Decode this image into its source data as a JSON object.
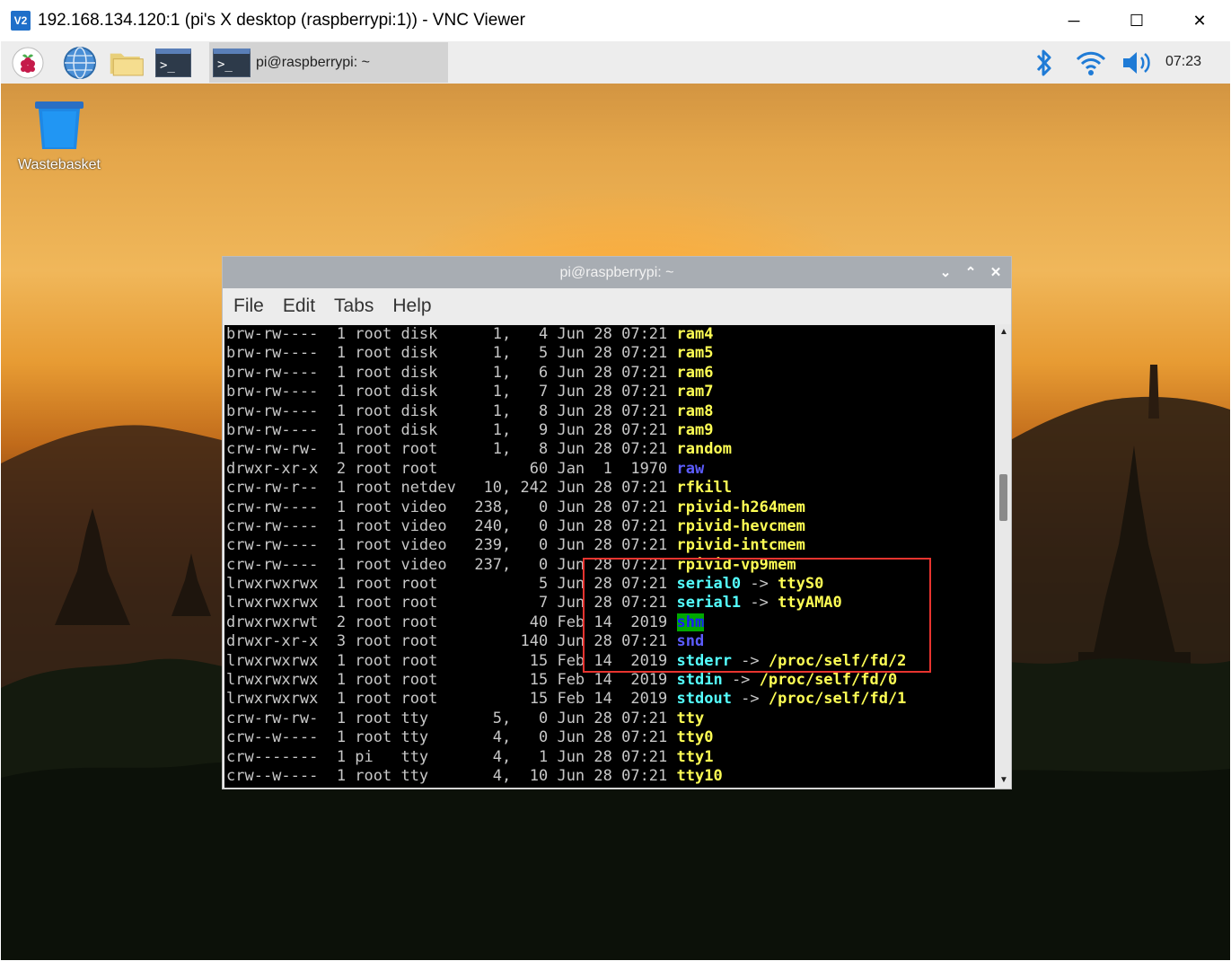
{
  "vnc": {
    "logo": "V2",
    "title": "192.168.134.120:1 (pi's X desktop (raspberrypi:1)) - VNC Viewer",
    "minimize": "─",
    "maximize": "☐",
    "close": "✕"
  },
  "taskbar": {
    "icons": [
      "raspberry-menu-icon",
      "web-browser-icon",
      "file-manager-icon",
      "terminal-icon"
    ],
    "task_label": "pi@raspberrypi: ~",
    "clock": "07:23",
    "tray": [
      "bluetooth-icon",
      "wifi-icon",
      "volume-icon"
    ]
  },
  "desktop": {
    "wastebasket_label": "Wastebasket"
  },
  "terminal": {
    "title": "pi@raspberrypi: ~",
    "menu": [
      "File",
      "Edit",
      "Tabs",
      "Help"
    ],
    "lines": [
      {
        "meta": "brw-rw----  1 root disk      1,   4 Jun 28 07:21 ",
        "name": "ram4",
        "color": "yellow"
      },
      {
        "meta": "brw-rw----  1 root disk      1,   5 Jun 28 07:21 ",
        "name": "ram5",
        "color": "yellow"
      },
      {
        "meta": "brw-rw----  1 root disk      1,   6 Jun 28 07:21 ",
        "name": "ram6",
        "color": "yellow"
      },
      {
        "meta": "brw-rw----  1 root disk      1,   7 Jun 28 07:21 ",
        "name": "ram7",
        "color": "yellow"
      },
      {
        "meta": "brw-rw----  1 root disk      1,   8 Jun 28 07:21 ",
        "name": "ram8",
        "color": "yellow"
      },
      {
        "meta": "brw-rw----  1 root disk      1,   9 Jun 28 07:21 ",
        "name": "ram9",
        "color": "yellow"
      },
      {
        "meta": "crw-rw-rw-  1 root root      1,   8 Jun 28 07:21 ",
        "name": "random",
        "color": "yellow"
      },
      {
        "meta": "drwxr-xr-x  2 root root          60 Jan  1  1970 ",
        "name": "raw",
        "color": "blue"
      },
      {
        "meta": "crw-rw-r--  1 root netdev   10, 242 Jun 28 07:21 ",
        "name": "rfkill",
        "color": "yellow"
      },
      {
        "meta": "crw-rw----  1 root video   238,   0 Jun 28 07:21 ",
        "name": "rpivid-h264mem",
        "color": "yellow"
      },
      {
        "meta": "crw-rw----  1 root video   240,   0 Jun 28 07:21 ",
        "name": "rpivid-hevcmem",
        "color": "yellow"
      },
      {
        "meta": "crw-rw----  1 root video   239,   0 Jun 28 07:21 ",
        "name": "rpivid-intcmem",
        "color": "yellow"
      },
      {
        "meta": "crw-rw----  1 root video   237,   0 Jun 28 07:21 ",
        "name": "rpivid-vp9mem",
        "color": "yellow"
      },
      {
        "meta": "lrwxrwxrwx  1 root root           5 Jun 28 07:21 ",
        "name": "serial0",
        "color": "cyan",
        "target": "ttyS0",
        "target_color": "yellow"
      },
      {
        "meta": "lrwxrwxrwx  1 root root           7 Jun 28 07:21 ",
        "name": "serial1",
        "color": "cyan",
        "target": "ttyAMA0",
        "target_color": "yellow"
      },
      {
        "meta": "drwxrwxrwt  2 root root          40 Feb 14  2019 ",
        "name": "shm",
        "color": "shm"
      },
      {
        "meta": "drwxr-xr-x  3 root root         140 Jun 28 07:21 ",
        "name": "snd",
        "color": "blue"
      },
      {
        "meta": "lrwxrwxrwx  1 root root          15 Feb 14  2019 ",
        "name": "stderr",
        "color": "cyan",
        "target": "/proc/self/fd/2",
        "target_color": "yellow"
      },
      {
        "meta": "lrwxrwxrwx  1 root root          15 Feb 14  2019 ",
        "name": "stdin",
        "color": "cyan",
        "target": "/proc/self/fd/0",
        "target_color": "yellow"
      },
      {
        "meta": "lrwxrwxrwx  1 root root          15 Feb 14  2019 ",
        "name": "stdout",
        "color": "cyan",
        "target": "/proc/self/fd/1",
        "target_color": "yellow"
      },
      {
        "meta": "crw-rw-rw-  1 root tty       5,   0 Jun 28 07:21 ",
        "name": "tty",
        "color": "yellow"
      },
      {
        "meta": "crw--w----  1 root tty       4,   0 Jun 28 07:21 ",
        "name": "tty0",
        "color": "yellow"
      },
      {
        "meta": "crw-------  1 pi   tty       4,   1 Jun 28 07:21 ",
        "name": "tty1",
        "color": "yellow"
      },
      {
        "meta": "crw--w----  1 root tty       4,  10 Jun 28 07:21 ",
        "name": "tty10",
        "color": "yellow"
      }
    ],
    "arrow": "->",
    "highlight_color": "#e8342f"
  }
}
